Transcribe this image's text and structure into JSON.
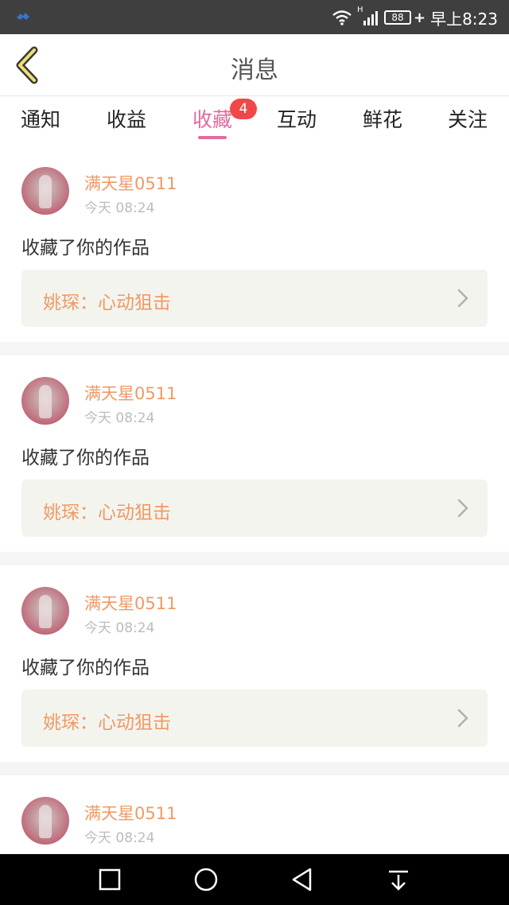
{
  "statusbar": {
    "time": "早上8:23",
    "battery": "88",
    "network_type": "H"
  },
  "header": {
    "title": "消息"
  },
  "tabs": [
    {
      "label": "通知"
    },
    {
      "label": "收益"
    },
    {
      "label": "收藏",
      "active": true,
      "badge": "4"
    },
    {
      "label": "互动"
    },
    {
      "label": "鲜花"
    },
    {
      "label": "关注"
    }
  ],
  "feed": [
    {
      "username": "满天星0511",
      "time": "今天 08:24",
      "action": "收藏了你的作品",
      "work": "姚琛：心动狙击"
    },
    {
      "username": "满天星0511",
      "time": "今天 08:24",
      "action": "收藏了你的作品",
      "work": "姚琛：心动狙击"
    },
    {
      "username": "满天星0511",
      "time": "今天 08:24",
      "action": "收藏了你的作品",
      "work": "姚琛：心动狙击"
    },
    {
      "username": "满天星0511",
      "time": "今天 08:24",
      "action": "",
      "work": ""
    }
  ],
  "colors": {
    "accent_pink": "#e46a9f",
    "username_orange": "#ee9a66",
    "badge_red": "#f04848"
  },
  "icons": {
    "back": "chevron-left-icon",
    "navbar": [
      "square-icon",
      "circle-icon",
      "triangle-back-icon",
      "download-icon"
    ]
  }
}
